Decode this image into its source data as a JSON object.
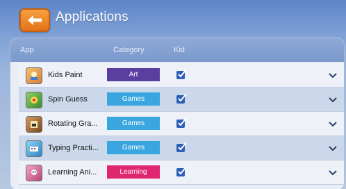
{
  "header": {
    "title": "Applications"
  },
  "columns": {
    "app": "App",
    "category": "Category",
    "kid": "Kid"
  },
  "colors": {
    "art": "#5a3fa0",
    "games": "#3aa6e0",
    "learning": "#e0266e",
    "accent_back": "#f08a26"
  },
  "rows": [
    {
      "name": "Kids Paint",
      "category": "Art",
      "kid": true,
      "icon": "paint-app-icon"
    },
    {
      "name": "Spin Guess",
      "category": "Games",
      "kid": true,
      "icon": "spin-guess-app-icon"
    },
    {
      "name": "Rotating Gra...",
      "category": "Games",
      "kid": true,
      "icon": "rotating-app-icon"
    },
    {
      "name": "Typing Practi...",
      "category": "Games",
      "kid": true,
      "icon": "typing-app-icon"
    },
    {
      "name": "Learning Ani...",
      "category": "Learning",
      "kid": true,
      "icon": "learning-app-icon"
    }
  ]
}
